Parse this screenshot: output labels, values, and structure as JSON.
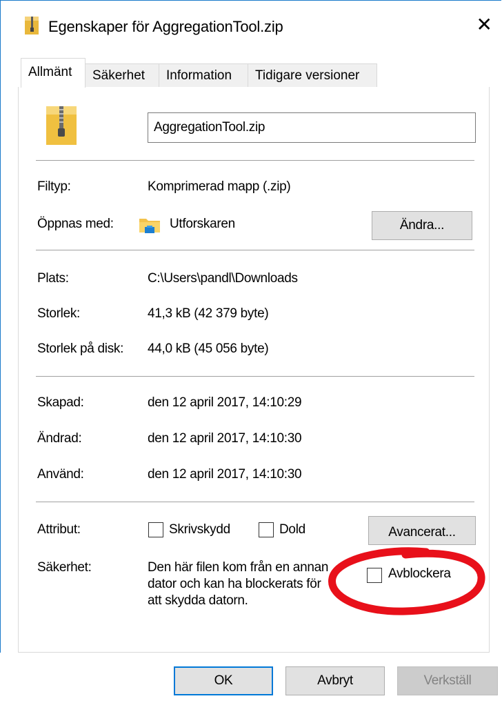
{
  "window": {
    "title": "Egenskaper för AggregationTool.zip"
  },
  "tabs": [
    {
      "label": "Allmänt"
    },
    {
      "label": "Säkerhet"
    },
    {
      "label": "Information"
    },
    {
      "label": "Tidigare versioner"
    }
  ],
  "general": {
    "filename": "AggregationTool.zip",
    "filetype_label": "Filtyp:",
    "filetype_value": "Komprimerad mapp (.zip)",
    "opens_with_label": "Öppnas med:",
    "opens_with_value": "Utforskaren",
    "change_button": "Ändra...",
    "location_label": "Plats:",
    "location_value": "C:\\Users\\pandl\\Downloads",
    "size_label": "Storlek:",
    "size_value": "41,3 kB (42 379 byte)",
    "size_on_disk_label": "Storlek på disk:",
    "size_on_disk_value": "44,0 kB (45 056 byte)",
    "created_label": "Skapad:",
    "created_value": "den 12 april 2017, 14:10:29",
    "modified_label": "Ändrad:",
    "modified_value": "den 12 april 2017, 14:10:30",
    "accessed_label": "Använd:",
    "accessed_value": "den 12 april 2017, 14:10:30",
    "attributes_label": "Attribut:",
    "readonly_label": "Skrivskydd",
    "readonly_checked": false,
    "hidden_label": "Dold",
    "hidden_checked": false,
    "advanced_button": "Avancerat...",
    "security_label": "Säkerhet:",
    "security_text_1": "Den här filen kom från en annan",
    "security_text_2": "dator och kan ha blockerats för",
    "security_text_3": "att skydda datorn.",
    "unblock_label": "Avblockera",
    "unblock_checked": false
  },
  "buttons": {
    "ok": "OK",
    "cancel": "Avbryt",
    "apply": "Verkställ"
  },
  "colors": {
    "accent": "#0078d7",
    "annotation": "#e8101a",
    "zip_yellow": "#f4c542"
  }
}
